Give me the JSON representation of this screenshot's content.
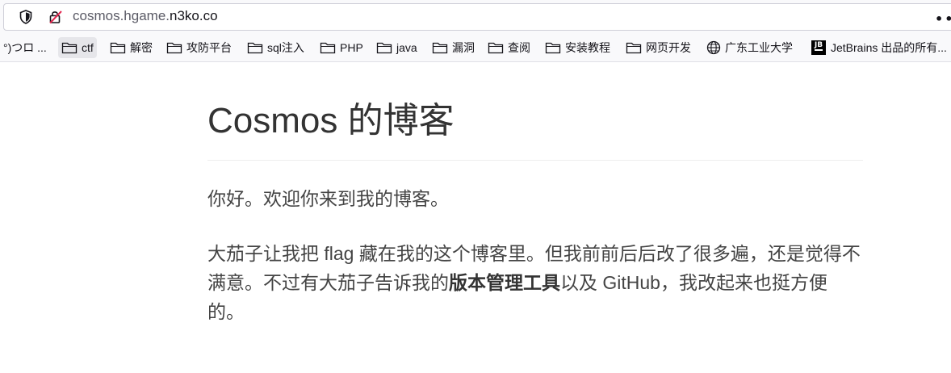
{
  "browser": {
    "url_prefix": "cosmos.hgame.",
    "url_domain": "n3ko.co",
    "more_label": "••"
  },
  "bookmarks": [
    {
      "label": "°)つロ ...",
      "icon": "none"
    },
    {
      "label": "ctf",
      "icon": "folder-icon"
    },
    {
      "label": "解密",
      "icon": "folder-icon"
    },
    {
      "label": "攻防平台",
      "icon": "folder-icon"
    },
    {
      "label": "sql注入",
      "icon": "folder-icon"
    },
    {
      "label": "PHP",
      "icon": "folder-icon"
    },
    {
      "label": "java",
      "icon": "folder-icon"
    },
    {
      "label": "漏洞",
      "icon": "folder-icon"
    },
    {
      "label": "查阅",
      "icon": "folder-icon"
    },
    {
      "label": "安装教程",
      "icon": "folder-icon"
    },
    {
      "label": "网页开发",
      "icon": "folder-icon"
    },
    {
      "label": "广东工业大学",
      "icon": "globe-icon"
    },
    {
      "label": "JetBrains 出品的所有...",
      "icon": "jetbrains-icon",
      "icon_text": "JB"
    }
  ],
  "page": {
    "title": "Cosmos 的博客",
    "greeting": "你好。欢迎你来到我的博客。",
    "body_part1": "大茄子让我把 flag 藏在我的这个博客里。但我前前后后改了很多遍，还是觉得不满意。不过有大茄子告诉我的",
    "body_bold": "版本管理工具",
    "body_part2": "以及 GitHub，我改起来也挺方便的。"
  }
}
